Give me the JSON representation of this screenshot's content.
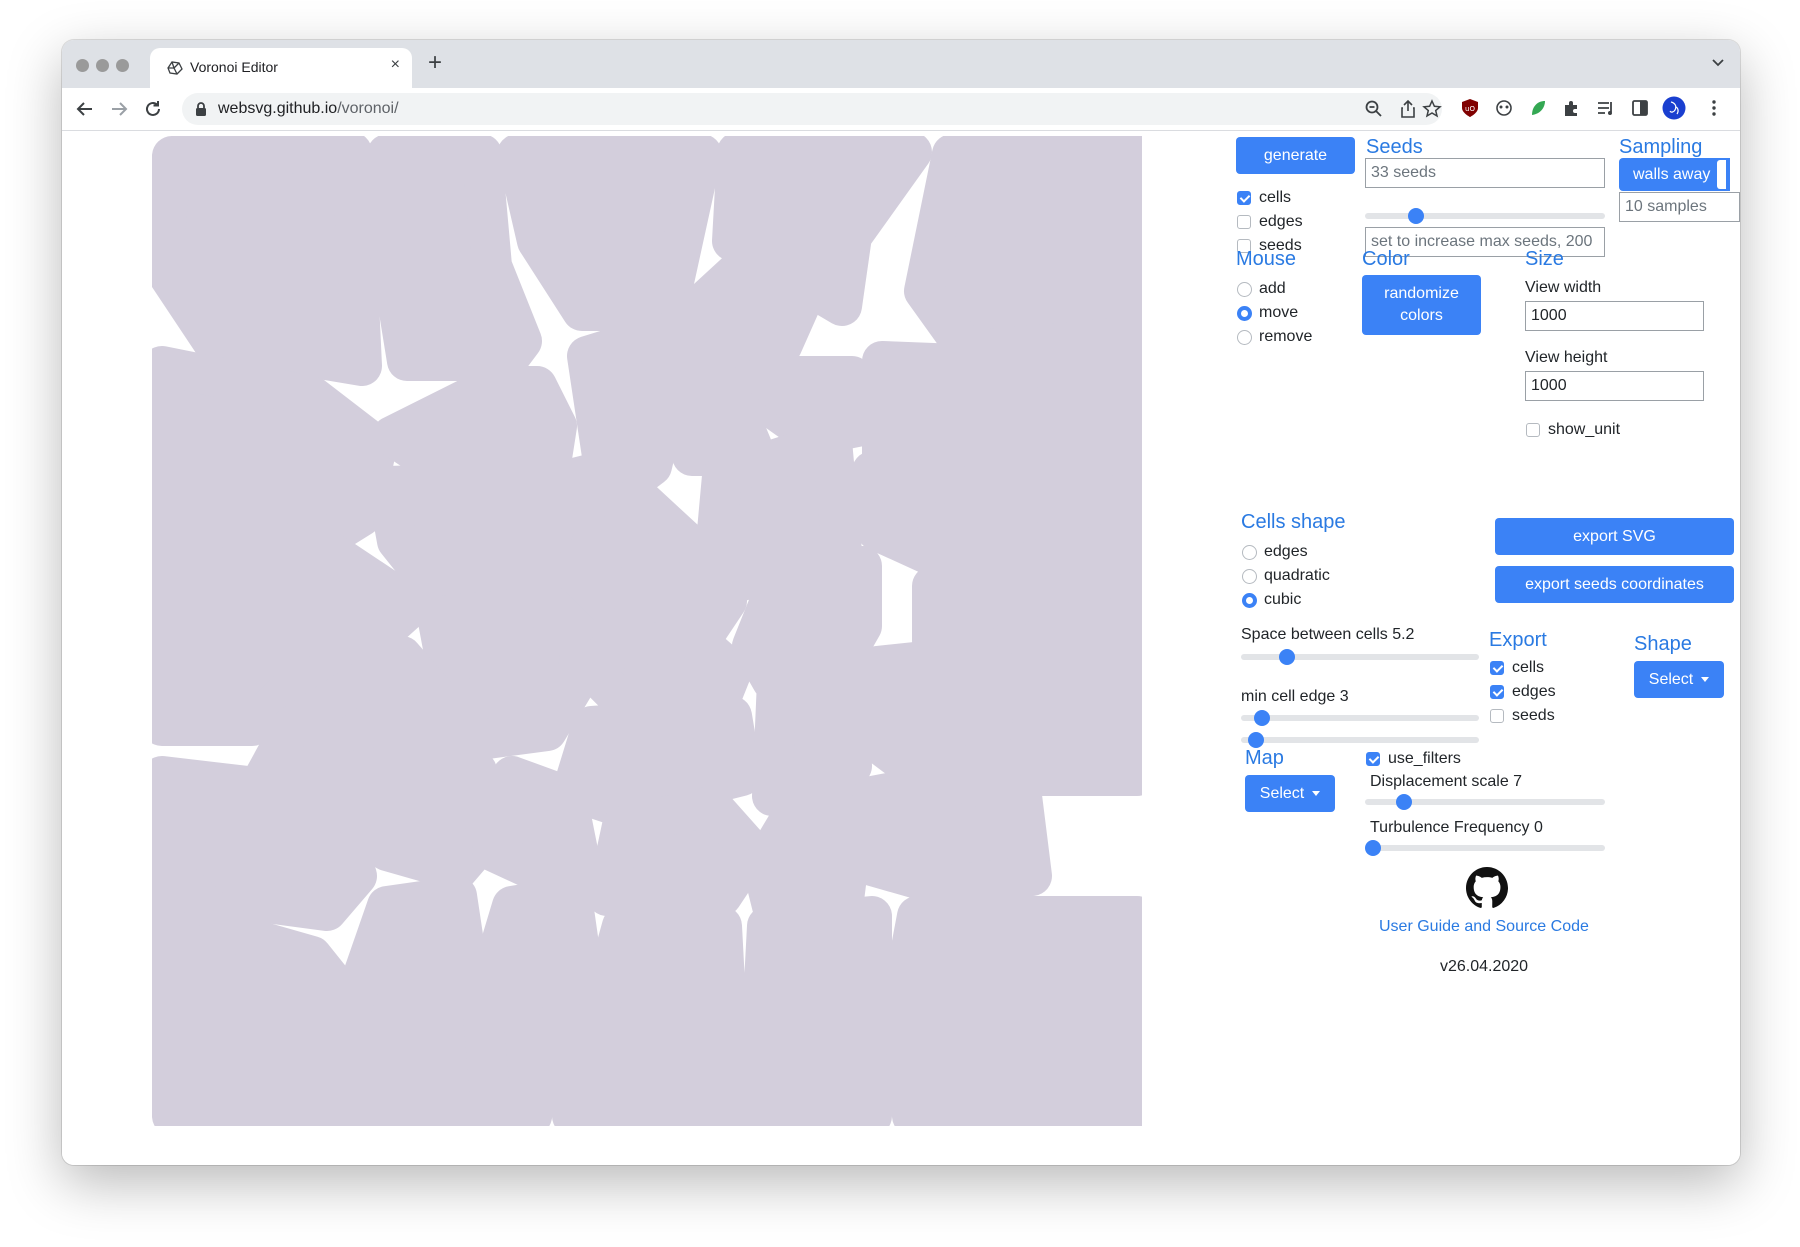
{
  "browser": {
    "tab_title": "Voronoi Editor",
    "tab_close": "×",
    "new_tab": "+",
    "url_host": "websvg.github.io",
    "url_path": "/voronoi/"
  },
  "icons": [
    "back-icon",
    "forward-icon",
    "reload-icon",
    "lock-icon",
    "zoom-icon",
    "share-icon",
    "star-icon",
    "ublock-icon",
    "extension-icon",
    "extensions-puzzle-icon",
    "reading-list-icon",
    "side-panel-icon",
    "profile-icon",
    "menu-icon",
    "github-icon"
  ],
  "colors": {
    "accent": "#3b82f6",
    "title": "#2a7ae2",
    "cell_fill": "#d3cedc"
  },
  "controls": {
    "generate_label": "generate",
    "view_checks": [
      {
        "label": "cells",
        "checked": true
      },
      {
        "label": "edges",
        "checked": false
      },
      {
        "label": "seeds",
        "checked": false
      }
    ],
    "seeds_title": "Seeds",
    "seeds_placeholder": "33 seeds",
    "seeds_slider": 0.19,
    "max_seeds_placeholder": "set to increase max seeds, 200",
    "sampling_title": "Sampling",
    "walls_away_label": "walls away",
    "samples_placeholder": "10 samples",
    "mouse_title": "Mouse",
    "mouse_options": [
      {
        "label": "add",
        "selected": false
      },
      {
        "label": "move",
        "selected": true
      },
      {
        "label": "remove",
        "selected": false
      }
    ],
    "color_title": "Color",
    "randomize_line1": "randomize",
    "randomize_line2": "colors",
    "size_title": "Size",
    "view_width_label": "View width",
    "view_width_value": "1000",
    "view_height_label": "View height",
    "view_height_value": "1000",
    "show_unit_label": "show_unit",
    "show_unit_checked": false,
    "cells_shape_title": "Cells shape",
    "shape_options": [
      {
        "label": "edges",
        "selected": false
      },
      {
        "label": "quadratic",
        "selected": false
      },
      {
        "label": "cubic",
        "selected": true
      }
    ],
    "space_label": "Space between cells 5.2",
    "space_slider": 0.17,
    "min_edge_label": "min cell edge 3",
    "min_edge_slider": 0.06,
    "extra_slider": 0.03,
    "export_svg_label": "export SVG",
    "export_seeds_label": "export seeds coordinates",
    "export_title": "Export",
    "export_checks": [
      {
        "label": "cells",
        "checked": true
      },
      {
        "label": "edges",
        "checked": true
      },
      {
        "label": "seeds",
        "checked": false
      }
    ],
    "shape_title": "Shape",
    "shape_select_label": "Select",
    "map_title": "Map",
    "map_select_label": "Select",
    "use_filters_label": "use_filters",
    "use_filters_checked": true,
    "displacement_label": "Displacement scale 7",
    "displacement_slider": 0.14,
    "turbulence_label": "Turbulence Frequency 0",
    "turbulence_slider": 0.0,
    "guide_link": "User Guide and Source Code",
    "version": "v26.04.2020"
  }
}
